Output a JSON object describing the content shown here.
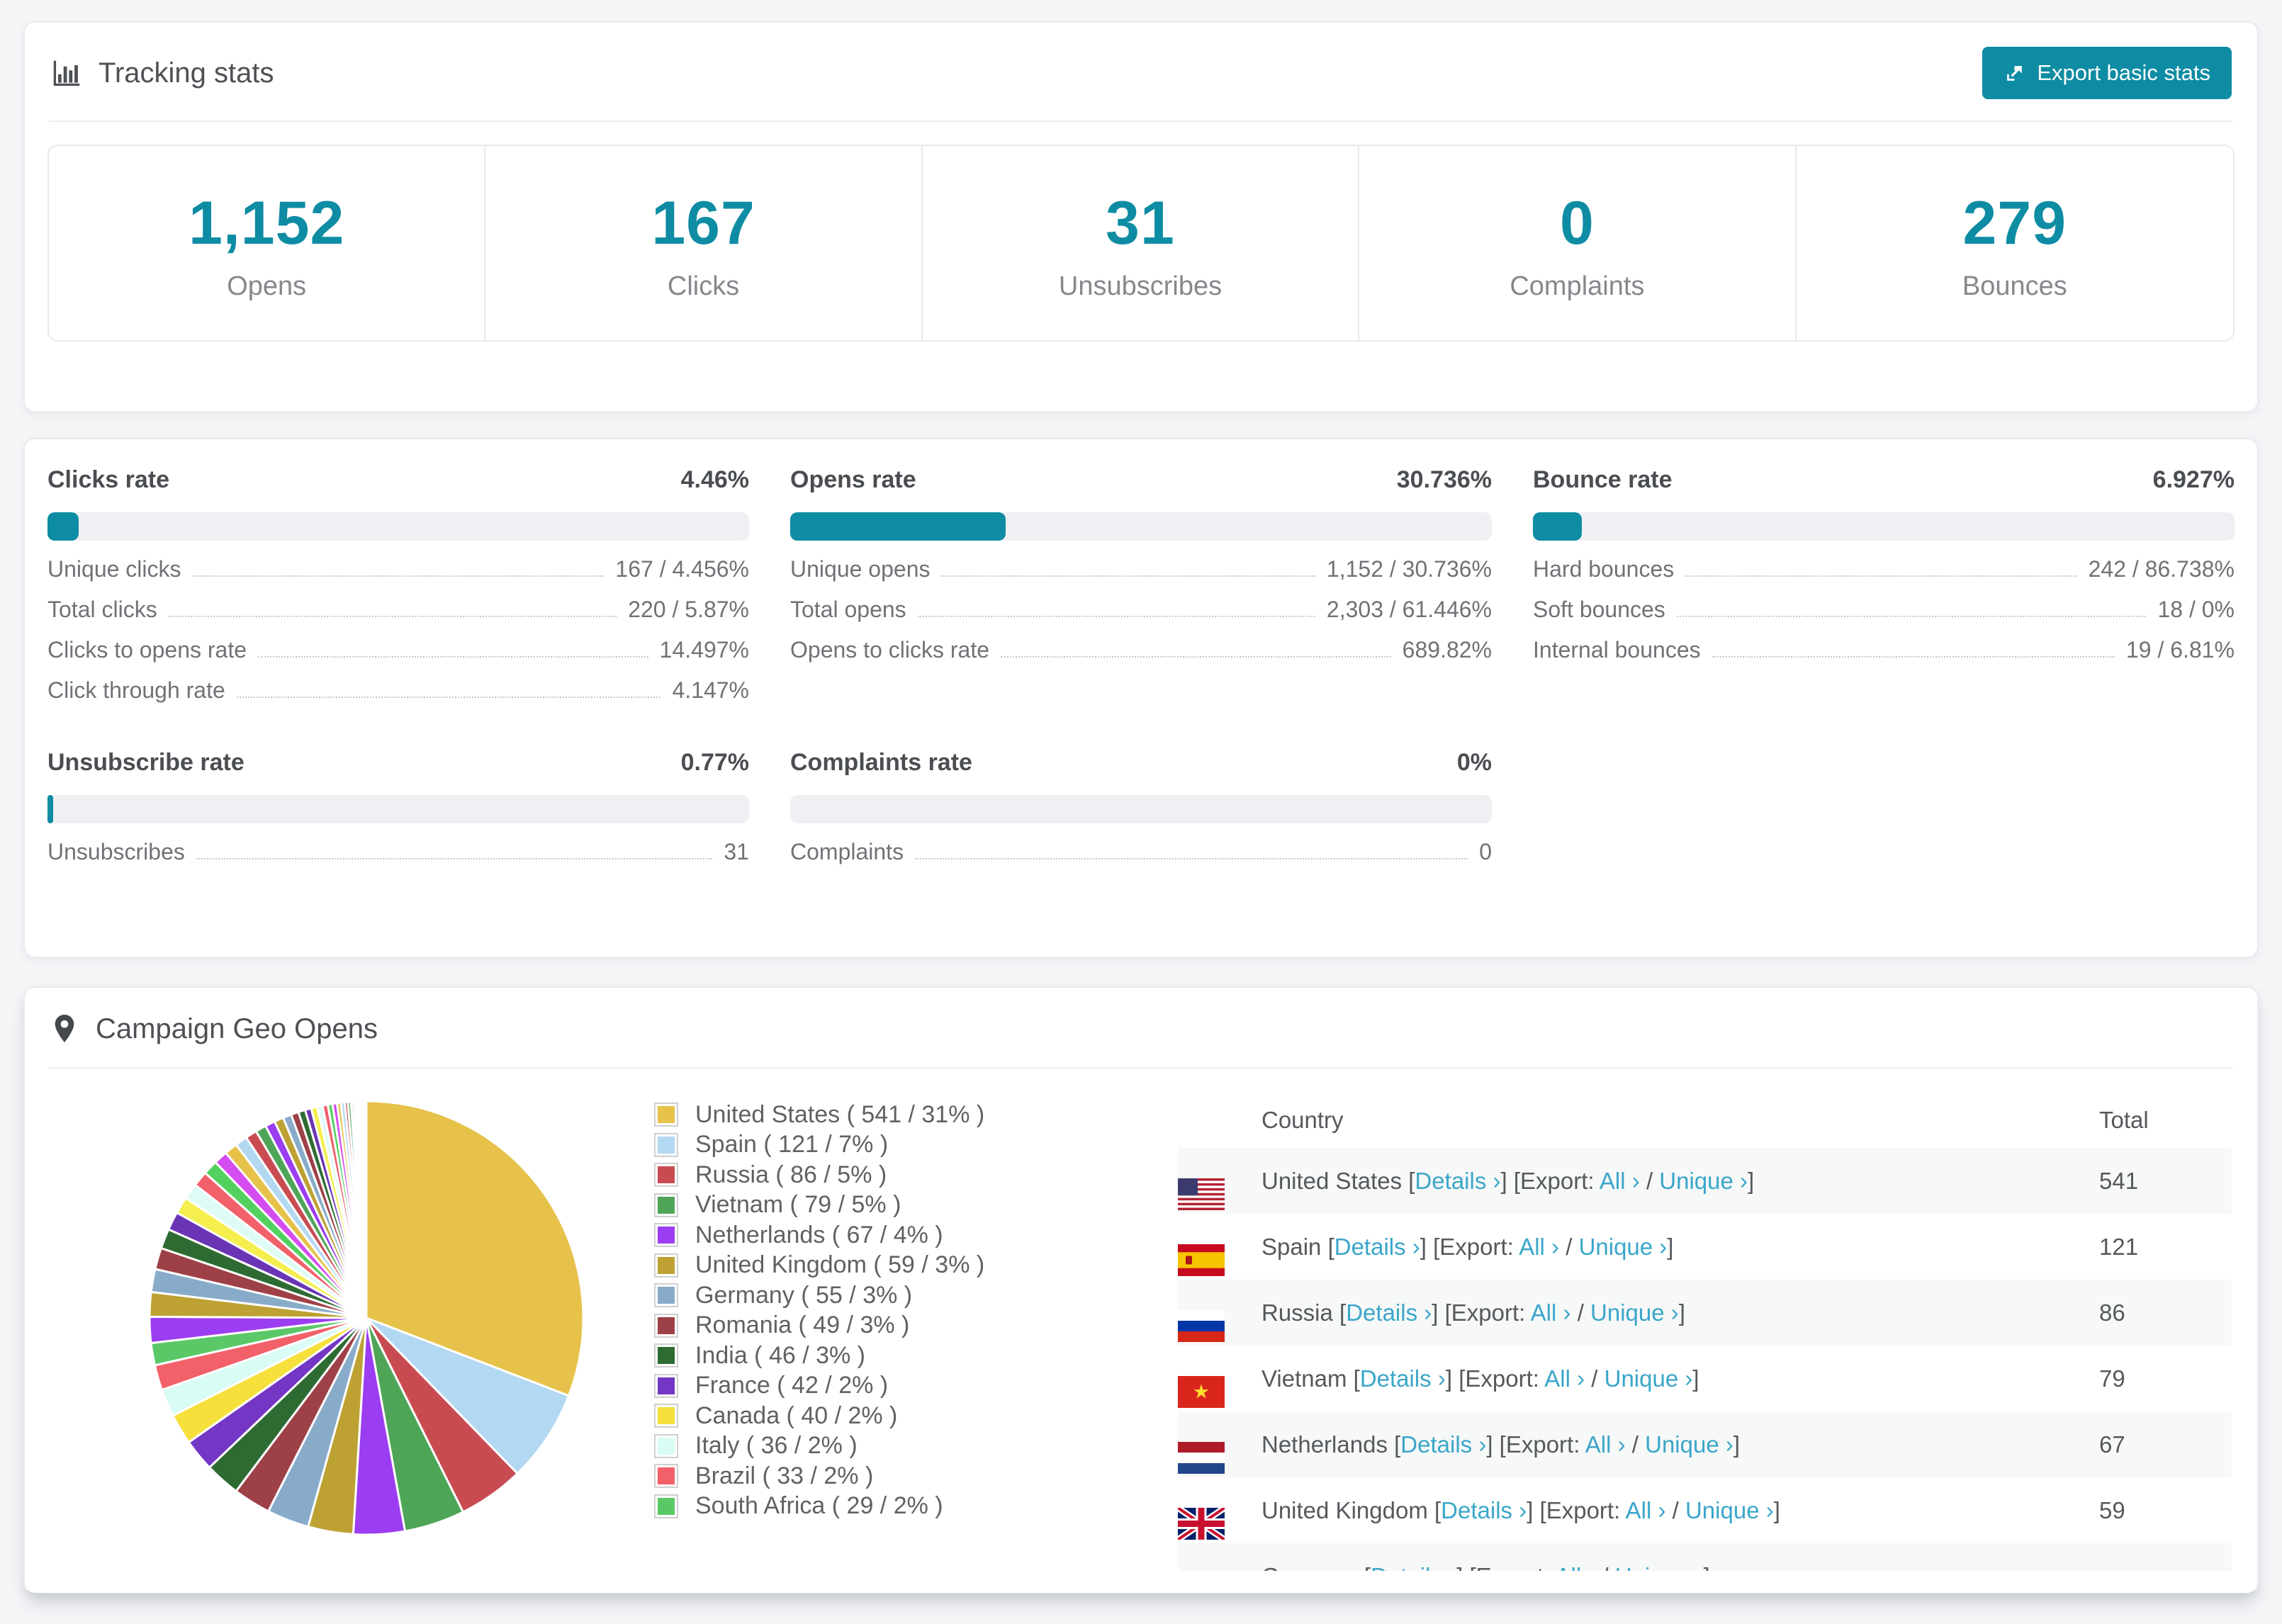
{
  "colors": {
    "accent": "#0e8ca3",
    "link": "#3aa6c9",
    "bar_track": "#eef0f3",
    "page_bg": "#f4f5f7"
  },
  "tracking_card": {
    "title": "Tracking stats",
    "export_button_label": "Export basic stats",
    "stats": [
      {
        "value": "1,152",
        "label": "Opens"
      },
      {
        "value": "167",
        "label": "Clicks"
      },
      {
        "value": "31",
        "label": "Unsubscribes"
      },
      {
        "value": "0",
        "label": "Complaints"
      },
      {
        "value": "279",
        "label": "Bounces"
      }
    ]
  },
  "rates_card": {
    "blocks": [
      {
        "title": "Clicks rate",
        "percent_label": "4.46%",
        "bar_percent": 4.46,
        "rows": [
          {
            "label": "Unique clicks",
            "value": "167 / 4.456%"
          },
          {
            "label": "Total clicks",
            "value": "220 / 5.87%"
          },
          {
            "label": "Clicks to opens rate",
            "value": "14.497%"
          },
          {
            "label": "Click through rate",
            "value": "4.147%"
          }
        ]
      },
      {
        "title": "Opens rate",
        "percent_label": "30.736%",
        "bar_percent": 30.736,
        "rows": [
          {
            "label": "Unique opens",
            "value": "1,152 / 30.736%"
          },
          {
            "label": "Total opens",
            "value": "2,303 / 61.446%"
          },
          {
            "label": "Opens to clicks rate",
            "value": "689.82%"
          }
        ]
      },
      {
        "title": "Bounce rate",
        "percent_label": "6.927%",
        "bar_percent": 6.927,
        "rows": [
          {
            "label": "Hard bounces",
            "value": "242 / 86.738%"
          },
          {
            "label": "Soft bounces",
            "value": "18 / 0%"
          },
          {
            "label": "Internal bounces",
            "value": "19 / 6.81%"
          }
        ]
      },
      {
        "title": "Unsubscribe rate",
        "percent_label": "0.77%",
        "bar_percent": 0.77,
        "rows": [
          {
            "label": "Unsubscribes",
            "value": "31"
          }
        ]
      },
      {
        "title": "Complaints rate",
        "percent_label": "0%",
        "bar_percent": 0,
        "rows": [
          {
            "label": "Complaints",
            "value": "0"
          }
        ]
      }
    ]
  },
  "geo_card": {
    "title": "Campaign Geo Opens",
    "table": {
      "country_header": "Country",
      "total_header": "Total",
      "details_label": "Details ›",
      "export_label": "Export:",
      "all_label": "All ›",
      "unique_label": "Unique ›",
      "bracket_open": "[",
      "bracket_close": "]",
      "slash": "/",
      "rows": [
        {
          "country": "United States",
          "flag": "us",
          "total": "541"
        },
        {
          "country": "Spain",
          "flag": "es",
          "total": "121"
        },
        {
          "country": "Russia",
          "flag": "ru",
          "total": "86"
        },
        {
          "country": "Vietnam",
          "flag": "vn",
          "total": "79"
        },
        {
          "country": "Netherlands",
          "flag": "nl",
          "total": "67"
        },
        {
          "country": "United Kingdom",
          "flag": "gb",
          "total": "59"
        },
        {
          "country": "Germany",
          "flag": "de",
          "total": ""
        }
      ]
    }
  },
  "chart_data": {
    "type": "pie",
    "title": "Campaign Geo Opens",
    "legend_position": "right",
    "start_angle_deg": 0,
    "direction": "clockwise",
    "slices": [
      {
        "label": "United States",
        "value": 541,
        "percent_label": "31%",
        "color": "#e6c24a"
      },
      {
        "label": "Spain",
        "value": 121,
        "percent_label": "7%",
        "color": "#b3d8f2"
      },
      {
        "label": "Russia",
        "value": 86,
        "percent_label": "5%",
        "color": "#c94b52"
      },
      {
        "label": "Vietnam",
        "value": 79,
        "percent_label": "5%",
        "color": "#4fa557"
      },
      {
        "label": "Netherlands",
        "value": 67,
        "percent_label": "4%",
        "color": "#9b3df0"
      },
      {
        "label": "United Kingdom",
        "value": 59,
        "percent_label": "3%",
        "color": "#bda133"
      },
      {
        "label": "Germany",
        "value": 55,
        "percent_label": "3%",
        "color": "#89abca"
      },
      {
        "label": "Romania",
        "value": 49,
        "percent_label": "3%",
        "color": "#9e4047"
      },
      {
        "label": "India",
        "value": 46,
        "percent_label": "3%",
        "color": "#2e6b33"
      },
      {
        "label": "France",
        "value": 42,
        "percent_label": "2%",
        "color": "#7436c4"
      },
      {
        "label": "Canada",
        "value": 40,
        "percent_label": "2%",
        "color": "#f6e03c"
      },
      {
        "label": "Italy",
        "value": 36,
        "percent_label": "2%",
        "color": "#d9fcf4"
      },
      {
        "label": "Brazil",
        "value": 33,
        "percent_label": "2%",
        "color": "#f2606a"
      },
      {
        "label": "South Africa",
        "value": 29,
        "percent_label": "2%",
        "color": "#5bc868"
      }
    ],
    "other_slices": {
      "note": "unlabeled small countries tapering to slivers",
      "values": [
        34,
        32,
        30,
        28,
        26,
        24,
        22,
        21,
        20,
        19,
        18,
        17,
        16,
        15,
        14,
        13,
        12,
        11,
        10,
        9,
        8,
        8,
        7,
        7,
        6,
        6,
        5,
        5,
        4,
        4,
        3,
        3,
        2,
        2,
        2,
        2,
        1,
        1,
        1,
        1,
        1,
        1
      ],
      "color_cycle": [
        "#9b3df0",
        "#bda133",
        "#89abca",
        "#9e4047",
        "#2e6b33",
        "#6a35b5",
        "#f5ef4e",
        "#dffbf6",
        "#f2606a",
        "#52d15e",
        "#d44df0",
        "#e6c24a",
        "#b3d8f2",
        "#c94b52",
        "#4fa557"
      ]
    }
  }
}
